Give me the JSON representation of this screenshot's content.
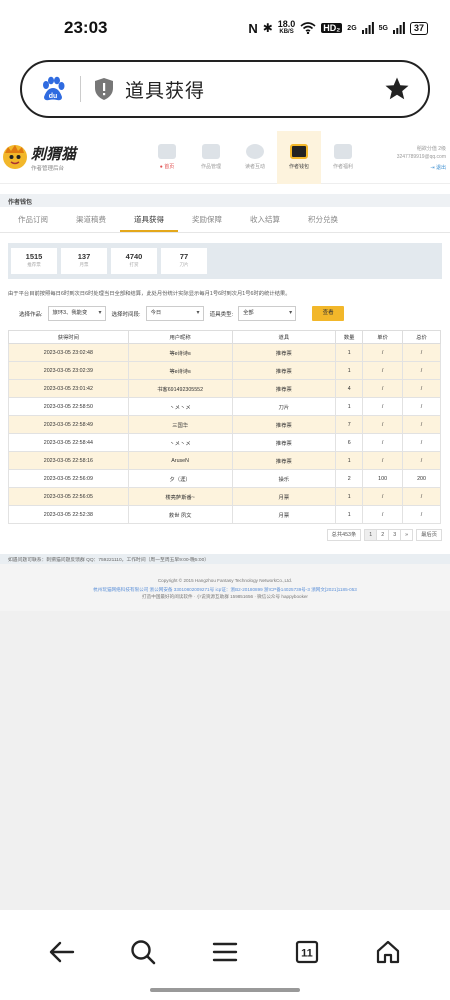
{
  "status": {
    "time": "23:03",
    "nfc": "N",
    "bluetooth": "✱",
    "speed_val": "18.0",
    "speed_unit": "KB/S",
    "hd": "HD₂",
    "sig1": "2G",
    "sig2": "5G",
    "battery": "37"
  },
  "browser": {
    "url_text": "道具获得",
    "icons": [
      "baidu-icon",
      "shield-icon",
      "star-icon"
    ]
  },
  "site": {
    "logo_title": "刺猬猫",
    "logo_subtitle": "作者管理后台",
    "nav": [
      {
        "label": "● 首页",
        "active": false
      },
      {
        "label": "作品管理",
        "active": false
      },
      {
        "label": "读者互动",
        "active": false
      },
      {
        "label": "作者钱包",
        "active": true
      },
      {
        "label": "作者福利",
        "active": false
      }
    ],
    "user": {
      "line1": "稻欲分值  2级",
      "line2": "3247789919@qq.com",
      "logout": "退出"
    },
    "crumb": "作者钱包",
    "tabs": [
      {
        "label": "作品订阅",
        "active": false
      },
      {
        "label": "渠道稿费",
        "active": false
      },
      {
        "label": "道具获得",
        "active": true
      },
      {
        "label": "奖励保障",
        "active": false
      },
      {
        "label": "收入结算",
        "active": false
      },
      {
        "label": "积分兑换",
        "active": false
      }
    ],
    "stats": [
      {
        "value": "1515",
        "label": "推荐票"
      },
      {
        "value": "137",
        "label": "月票"
      },
      {
        "value": "4740",
        "label": "打赏"
      },
      {
        "value": "77",
        "label": "刀片"
      }
    ],
    "notice": "由于平台目前按照每日6时到次日6时处理当日全部和结算，此处月份统计实际显示每月1号6时到次月1号6时的统计结果。",
    "filters": {
      "work_label": "选择作品:",
      "work_value": "旅环3、我能变",
      "period_label": "选择时间段:",
      "period_value": "今日",
      "type_label": "道具类型:",
      "type_value": "全部",
      "search": "查看"
    },
    "table": {
      "headers": [
        "获得时间",
        "用户昵称",
        "道具",
        "数量",
        "单价",
        "总价"
      ],
      "rows": [
        [
          "2023-03-05 23:02:48",
          "等ʚ诗诗ɞ",
          "推荐票",
          "1",
          "/",
          "/"
        ],
        [
          "2023-03-05 23:02:39",
          "等ʚ诗诗ɞ",
          "推荐票",
          "1",
          "/",
          "/"
        ],
        [
          "2023-03-05 23:01:42",
          "书客691492305552",
          "推荐票",
          "4",
          "/",
          "/"
        ],
        [
          "2023-03-05 22:58:50",
          "丶メ丶メ",
          "刀片",
          "1",
          "/",
          "/"
        ],
        [
          "2023-03-05 22:58:49",
          "三国华",
          "推荐票",
          "7",
          "/",
          "/"
        ],
        [
          "2023-03-05 22:58:44",
          "丶メ丶メ",
          "推荐票",
          "6",
          "/",
          "/"
        ],
        [
          "2023-03-05 22:58:16",
          "AruseN",
          "推荐票",
          "1",
          "/",
          "/"
        ],
        [
          "2023-03-05 22:56:09",
          "夕（涯）",
          "操乐",
          "2",
          "100",
          "200"
        ],
        [
          "2023-03-05 22:56:05",
          "楼亮萨斯番~",
          "月票",
          "1",
          "/",
          "/"
        ],
        [
          "2023-03-05 22:52:38",
          "救世 夙文",
          "月票",
          "1",
          "/",
          "/"
        ]
      ],
      "highlight": [
        0,
        1,
        2,
        4,
        6,
        8
      ]
    },
    "pager": {
      "total": "总共453条",
      "pages": [
        "1",
        "2",
        "3",
        "»"
      ],
      "last": "最后页"
    },
    "footer_band": "如遇问题可联系：刺猬猫问题反馈群 QQ：759221110，工作时间（周一至周五早9:00-晚5:00）",
    "copyright": "Copyright © 2015 Hangzhou Fantasy Technology NetworkCo.,Ltd.",
    "license": "杭州玩猫网络科技有限公司   浙公网安备 33010802009271号   icp证：浙B2-20180899   浙ICP备14025739号-3   浙网文[2021]1185-053",
    "slogan": "打造中国最好的阅读软件 · 小说资源互助群 159851656 · 微信公众号 happybooker"
  }
}
